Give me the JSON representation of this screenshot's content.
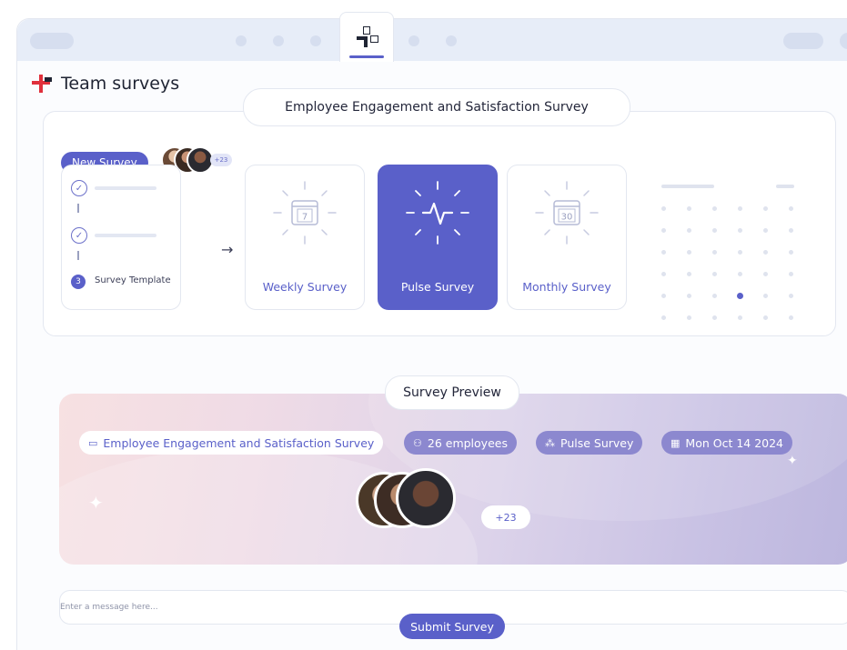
{
  "app": {
    "title": "Team surveys"
  },
  "survey": {
    "title": "Employee Engagement and Satisfaction Survey",
    "new_survey_label": "New Survey",
    "participants_mini_count": "+23",
    "template_step_number": "3",
    "template_label": "Survey Template",
    "options": [
      {
        "label": "Weekly Survey",
        "icon": "calendar-7-icon",
        "day": "7",
        "selected": false
      },
      {
        "label": "Pulse Survey",
        "icon": "pulse-icon",
        "selected": true
      },
      {
        "label": "Monthly Survey",
        "icon": "calendar-30-icon",
        "day": "30",
        "selected": false
      }
    ]
  },
  "preview": {
    "title": "Survey Preview",
    "survey_name": "Employee Engagement and Satisfaction Survey",
    "employees": "26 employees",
    "type": "Pulse Survey",
    "date": "Mon Oct 14 2024",
    "more_count": "+23"
  },
  "message": {
    "placeholder": "Enter a message here..."
  },
  "submit_label": "Submit Survey",
  "colors": {
    "accent": "#5a60c9",
    "brand_red": "#e0303c"
  }
}
